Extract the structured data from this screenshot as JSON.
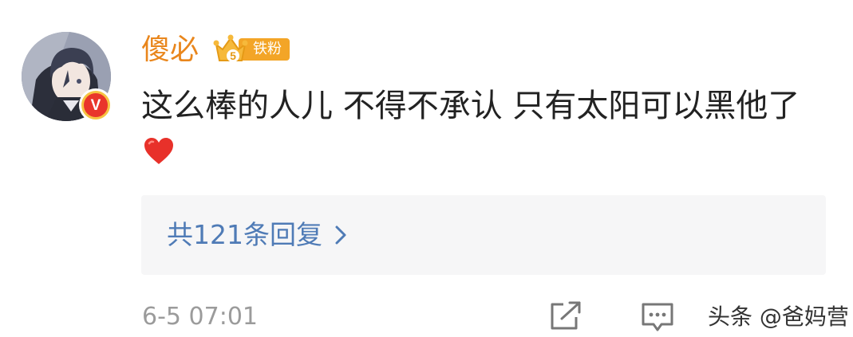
{
  "user": {
    "name": "傻必",
    "verified_badge": "V",
    "fan_badge": {
      "level": "5",
      "label": "铁粉"
    }
  },
  "comment": {
    "text": "这么棒的人儿 不得不承认 只有太阳可以黑他了",
    "emoji": "heart-emoji"
  },
  "replies": {
    "label": "共121条回复"
  },
  "meta": {
    "time": "6-5 07:01"
  },
  "watermark": "头条 @爸妈营",
  "colors": {
    "username": "#e9861c",
    "reply_link": "#4f7bb6",
    "badge": "#f3a527",
    "verified": "#e9352b"
  }
}
